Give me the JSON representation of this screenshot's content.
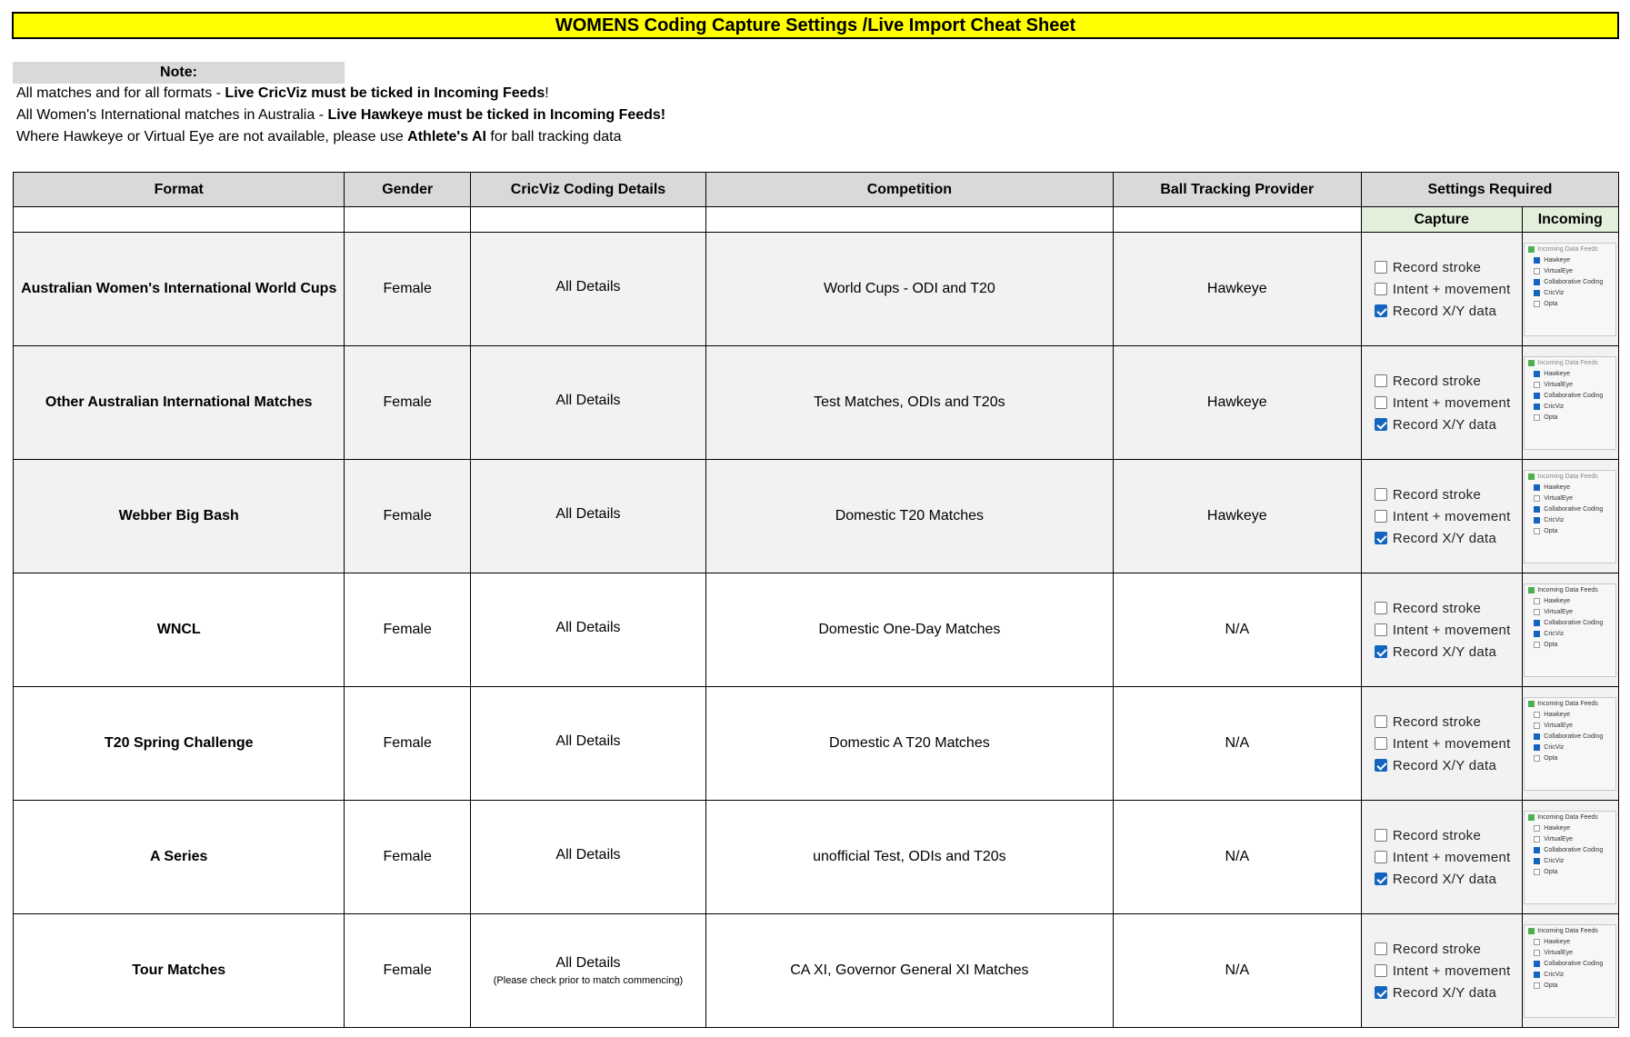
{
  "title": "WOMENS Coding Capture Settings /Live Import Cheat Sheet",
  "note": {
    "label": "Note:",
    "line1_pre": "All matches and for all formats - ",
    "line1_bold": "Live CricViz must be ticked in Incoming Feeds",
    "line1_post": "!",
    "line2_pre": "All Women's International matches in Australia - ",
    "line2_bold": "Live Hawkeye must be ticked in Incoming Feeds!",
    "line3_pre": "Where Hawkeye or Virtual Eye are not available, please use ",
    "line3_bold": "Athlete's AI",
    "line3_post": " for ball tracking data"
  },
  "headers": {
    "format": "Format",
    "gender": "Gender",
    "cricviz": "CricViz Coding Details",
    "competition": "Competition",
    "ball_tracking": "Ball Tracking Provider",
    "settings": "Settings Required",
    "capture": "Capture",
    "incoming": "Incoming"
  },
  "capture_labels": {
    "stroke": "Record stroke",
    "intent": "Intent + movement",
    "xy": "Record X/Y data"
  },
  "feed_labels": {
    "title": "Incoming Data Feeds",
    "hawkeye": "Hawkeye",
    "virtualeye": "VirtualEye",
    "collab": "Collaborative Coding",
    "cricviz": "CricViz",
    "opta": "Opta"
  },
  "rows": [
    {
      "format": "Australian Women's International World Cups",
      "gender": "Female",
      "cricviz": "All Details",
      "cricviz_note": "",
      "competition": "World Cups - ODI and T20",
      "ball_tracking": "Hawkeye"
    },
    {
      "format": "Other Australian International Matches",
      "gender": "Female",
      "cricviz": "All Details",
      "cricviz_note": "",
      "competition": "Test Matches, ODIs and T20s",
      "ball_tracking": "Hawkeye"
    },
    {
      "format": "Webber Big Bash",
      "gender": "Female",
      "cricviz": "All Details",
      "cricviz_note": "",
      "competition": "Domestic T20 Matches",
      "ball_tracking": "Hawkeye"
    },
    {
      "format": "WNCL",
      "gender": "Female",
      "cricviz": "All Details",
      "cricviz_note": "",
      "competition": "Domestic One-Day Matches",
      "ball_tracking": "N/A"
    },
    {
      "format": "T20 Spring Challenge",
      "gender": "Female",
      "cricviz": "All Details",
      "cricviz_note": "",
      "competition": "Domestic A T20 Matches",
      "ball_tracking": "N/A"
    },
    {
      "format": "A Series",
      "gender": "Female",
      "cricviz": "All Details",
      "cricviz_note": "",
      "competition": "unofficial Test, ODIs and T20s",
      "ball_tracking": "N/A"
    },
    {
      "format": "Tour Matches",
      "gender": "Female",
      "cricviz": "All Details",
      "cricviz_note": "(Please check prior to match commencing)",
      "competition": "CA XI, Governor General XI Matches",
      "ball_tracking": "N/A"
    }
  ]
}
